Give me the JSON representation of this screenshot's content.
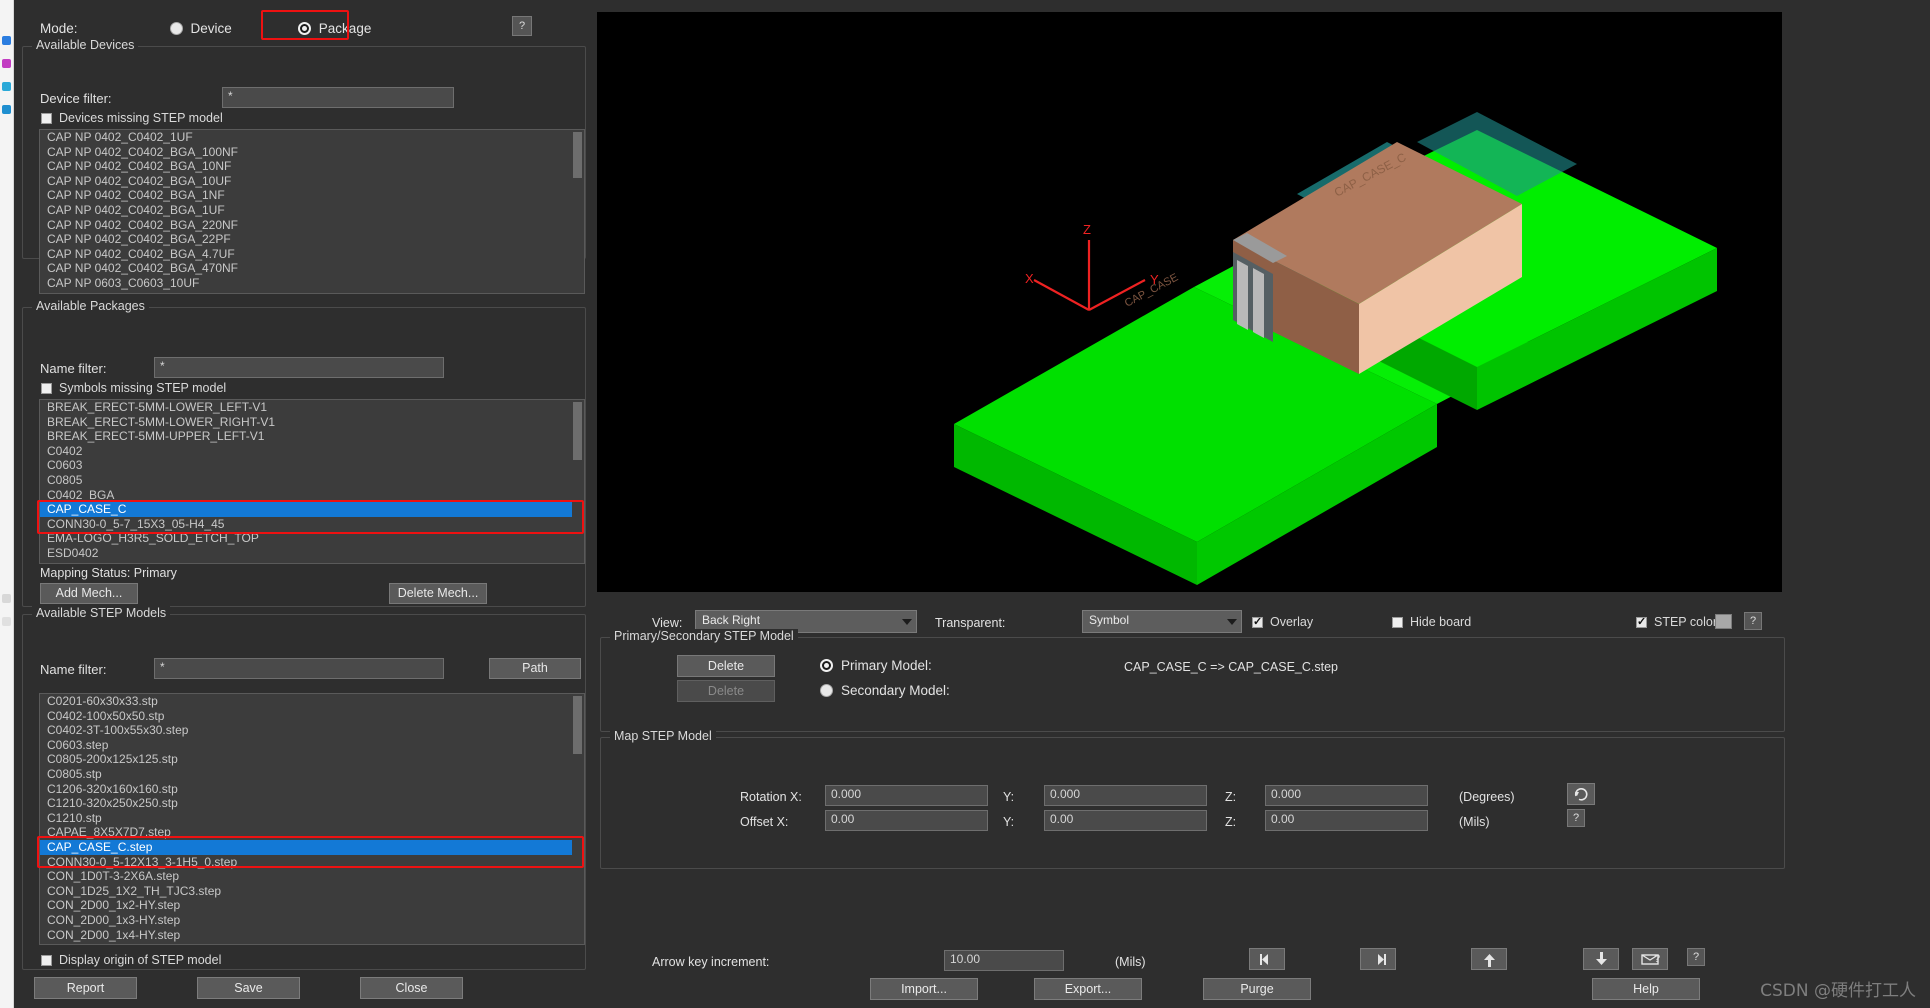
{
  "window": {
    "mode_label": "Mode:",
    "mode_options": [
      "Device",
      "Package"
    ],
    "mode_selected": "Package",
    "help_button": "?"
  },
  "available_devices": {
    "legend": "Available Devices",
    "filter_label": "Device filter:",
    "filter_value": "*",
    "missing_step_label": "Devices missing STEP model",
    "missing_step_checked": false,
    "items": [
      "CAP NP 0402_C0402_1UF",
      "CAP NP 0402_C0402_BGA_100NF",
      "CAP NP 0402_C0402_BGA_10NF",
      "CAP NP 0402_C0402_BGA_10UF",
      "CAP NP 0402_C0402_BGA_1NF",
      "CAP NP 0402_C0402_BGA_1UF",
      "CAP NP 0402_C0402_BGA_220NF",
      "CAP NP 0402_C0402_BGA_22PF",
      "CAP NP 0402_C0402_BGA_4.7UF",
      "CAP NP 0402_C0402_BGA_470NF",
      "CAP NP 0603_C0603_10UF"
    ]
  },
  "available_packages": {
    "legend": "Available Packages",
    "filter_label": "Name filter:",
    "filter_value": "*",
    "missing_step_label": "Symbols missing STEP model",
    "missing_step_checked": false,
    "items": [
      "BREAK_ERECT-5MM-LOWER_LEFT-V1",
      "BREAK_ERECT-5MM-LOWER_RIGHT-V1",
      "BREAK_ERECT-5MM-UPPER_LEFT-V1",
      "C0402",
      "C0603",
      "C0805",
      "C0402_BGA",
      "CAP_CASE_C",
      "CONN30-0_5-7_15X3_05-H4_45",
      "EMA-LOGO_H3R5_SOLD_ETCH_TOP",
      "ESD0402"
    ],
    "selected": "CAP_CASE_C",
    "mapping_status": "Mapping Status: Primary",
    "add_mech_label": "Add Mech...",
    "delete_mech_label": "Delete Mech..."
  },
  "available_step_models": {
    "legend": "Available STEP Models",
    "filter_label": "Name filter:",
    "filter_value": "*",
    "path_button": "Path",
    "items": [
      "C0201-60x30x33.stp",
      "C0402-100x50x50.stp",
      "C0402-3T-100x55x30.step",
      "C0603.step",
      "C0805-200x125x125.stp",
      "C0805.stp",
      "C1206-320x160x160.stp",
      "C1210-320x250x250.stp",
      "C1210.stp",
      "CAPAE_8X5X7D7.step",
      "CAP_CASE_C.step",
      "CONN30-0_5-12X13_3-1H5_0.step",
      "CON_1D0T-3-2X6A.step",
      "CON_1D25_1X2_TH_TJC3.step",
      "CON_2D00_1x2-HY.step",
      "CON_2D00_1x3-HY.step",
      "CON_2D00_1x4-HY.step"
    ],
    "selected": "CAP_CASE_C.step",
    "display_origin_label": "Display origin of STEP model",
    "display_origin_checked": false
  },
  "footer": {
    "report": "Report",
    "save": "Save",
    "close": "Close",
    "help": "Help"
  },
  "viewer_controls": {
    "view_label": "View:",
    "view_value": "Back Right",
    "transparent_label": "Transparent:",
    "transparent_value": "Symbol",
    "overlay_label": "Overlay",
    "overlay_checked": true,
    "hide_board_label": "Hide board",
    "hide_board_checked": false,
    "step_color_label": "STEP color",
    "step_color_checked": true,
    "step_color_swatch": "#a8a8a8",
    "help_button": "?"
  },
  "primary_secondary": {
    "legend": "Primary/Secondary STEP Model",
    "delete_primary": "Delete",
    "delete_secondary": "Delete",
    "primary_model_label": "Primary Model:",
    "secondary_model_label": "Secondary Model:",
    "primary_selected": true,
    "mapping_text": "CAP_CASE_C => CAP_CASE_C.step"
  },
  "map_step_model": {
    "legend": "Map STEP Model",
    "rotation_label": "Rotation X:",
    "rotation_x": "0.000",
    "rotation_y_label": "Y:",
    "rotation_y": "0.000",
    "rotation_z_label": "Z:",
    "rotation_z": "0.000",
    "degrees_label": "(Degrees)",
    "offset_label": "Offset    X:",
    "offset_x": "0.00",
    "offset_y_label": "Y:",
    "offset_y": "0.00",
    "offset_z_label": "Z:",
    "offset_z": "0.00",
    "mils_label": "(Mils)",
    "rotate_icon": "rotate-icon",
    "help_button": "?"
  },
  "arrow_controls": {
    "label": "Arrow key increment:",
    "value": "10.00",
    "units": "(Mils)",
    "buttons": [
      "move-left-icon",
      "move-right-icon",
      "move-up-icon",
      "move-down-icon",
      "flip-icon",
      "help-icon"
    ],
    "import": "Import...",
    "export": "Export...",
    "purge": "Purge"
  },
  "viewport_3d": {
    "axis_labels": {
      "z": "Z",
      "x": "X",
      "y": "Y"
    },
    "component_label": "CAP_CASE_C",
    "board_color": "#00e800",
    "component_color": "#b07a5e",
    "axis_color": "#ee2222"
  },
  "watermark": "CSDN @硬件打工人"
}
